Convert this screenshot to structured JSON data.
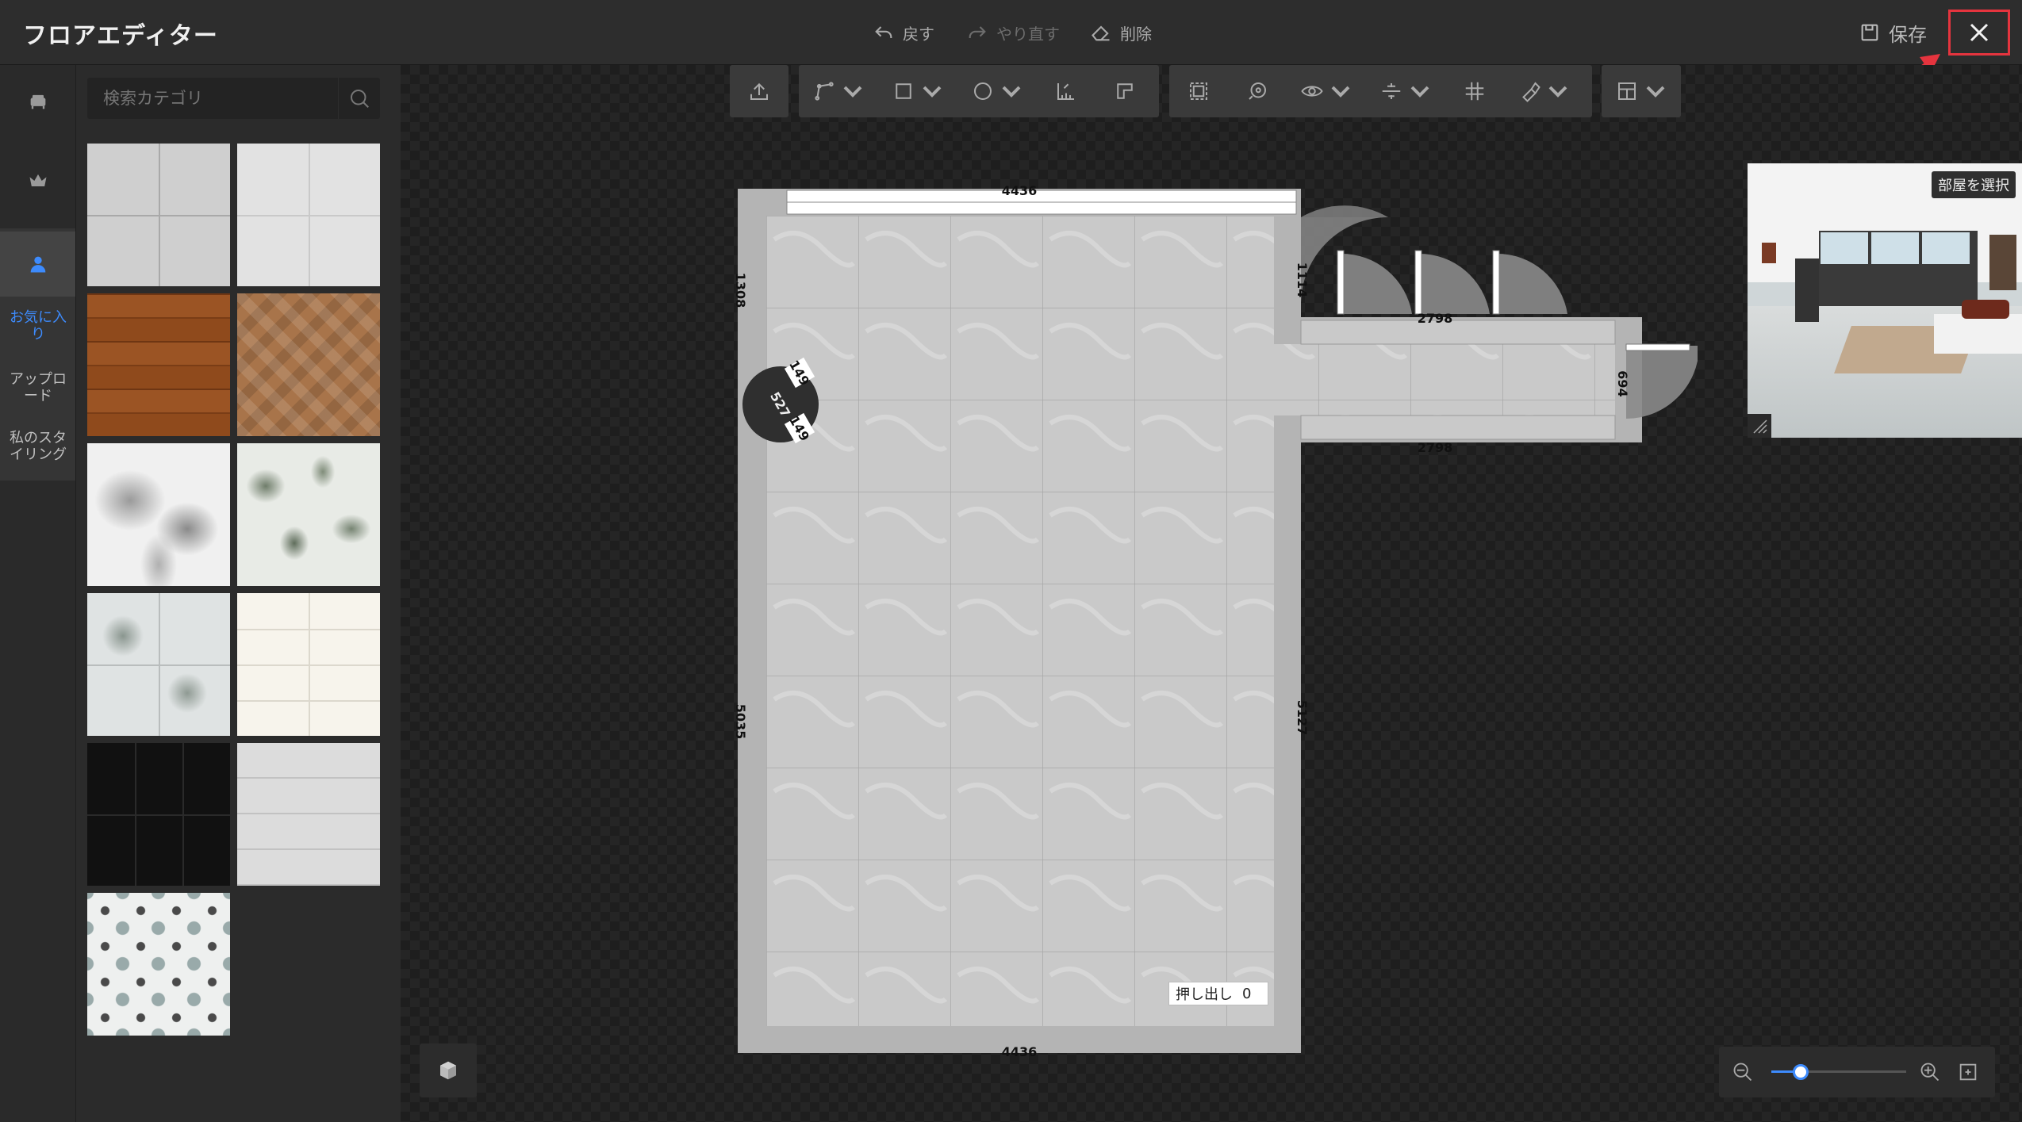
{
  "app": {
    "title": "フロアエディター"
  },
  "header": {
    "undo_label": "戻す",
    "redo_label": "やり直す",
    "delete_label": "削除",
    "save_label": "保存",
    "close_icon": "close-icon"
  },
  "rail": {
    "items": [
      {
        "icon": "furniture-icon"
      },
      {
        "icon": "crown-icon"
      },
      {
        "icon": "user-icon"
      }
    ],
    "favorites_label": "お気に入り",
    "upload_label": "アップロード",
    "my_styling_label": "私のスタイリング"
  },
  "search": {
    "placeholder": "検索カテゴリ"
  },
  "materials": [
    {
      "name": "gray-tile"
    },
    {
      "name": "light-gray-marble"
    },
    {
      "name": "wood-plank"
    },
    {
      "name": "herringbone-wood"
    },
    {
      "name": "white-marble"
    },
    {
      "name": "leaf-pattern"
    },
    {
      "name": "floral-tile"
    },
    {
      "name": "cream-tile"
    },
    {
      "name": "black-tile"
    },
    {
      "name": "white-brick"
    },
    {
      "name": "star-pattern-tile"
    }
  ],
  "plan": {
    "dims": {
      "top": "4436",
      "bottom": "4436",
      "left_upper": "1308",
      "left_lower": "5035",
      "right": "5127",
      "corridor_top": "2798",
      "corridor_bottom": "2798",
      "door_right": "1114",
      "end": "694",
      "fixture_a": "149",
      "fixture_b": "149",
      "fixture_c": "527"
    },
    "extrude_label": "押し出し",
    "extrude_value": "0"
  },
  "preview": {
    "label": "部屋を選択"
  },
  "zoom": {
    "level": 0.22
  },
  "colors": {
    "accent": "#3d8bfd",
    "highlight": "#e5343e"
  }
}
